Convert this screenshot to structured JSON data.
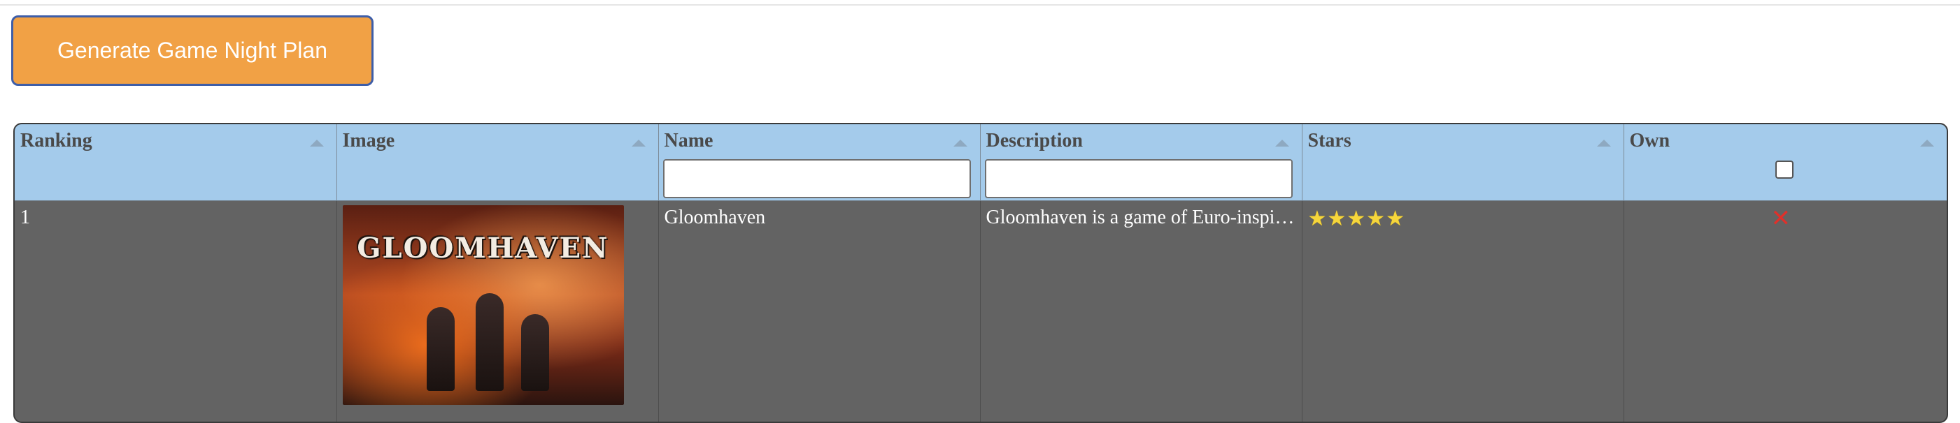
{
  "actions": {
    "generate_label": "Generate Game Night Plan"
  },
  "table": {
    "columns": [
      {
        "key": "ranking",
        "label": "Ranking",
        "filter": false
      },
      {
        "key": "image",
        "label": "Image",
        "filter": false
      },
      {
        "key": "name",
        "label": "Name",
        "filter": true,
        "placeholder": ""
      },
      {
        "key": "description",
        "label": "Description",
        "filter": true,
        "placeholder": ""
      },
      {
        "key": "stars",
        "label": "Stars",
        "filter": false
      },
      {
        "key": "own",
        "label": "Own",
        "filter": "checkbox"
      }
    ],
    "rows": [
      {
        "ranking": "1",
        "image_text": "GLOOMHAVEN",
        "name": "Gloomhaven",
        "description": "Gloomhaven is a game of Euro-inspi…",
        "stars": "★★★★★",
        "rating": 5,
        "own": "✕"
      }
    ]
  },
  "colors": {
    "button_bg": "#f1a145",
    "button_border": "#3e5ea8",
    "header_bg": "#a4cbeb",
    "row_bg": "#636363",
    "star": "#f6d63b",
    "not_owned": "#e0302a"
  },
  "icons": {
    "sort": "sort-ascending-icon",
    "own_false": "close-icon"
  }
}
